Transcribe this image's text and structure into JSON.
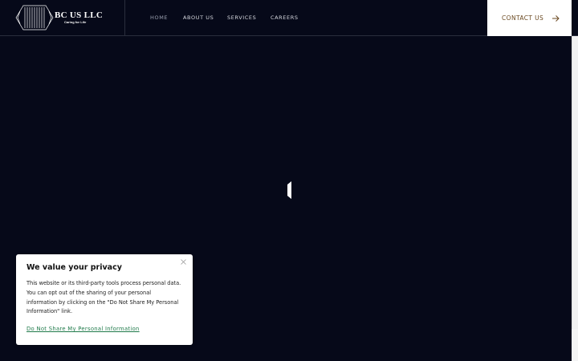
{
  "header": {
    "logo": {
      "name": "BC US  LLC",
      "tagline": "Caring for Life",
      "icon": "hexagon-lines-logo-icon"
    },
    "nav": [
      {
        "label": "HOME",
        "active": true
      },
      {
        "label": "ABOUT US",
        "active": false
      },
      {
        "label": "SERVICES",
        "active": false
      },
      {
        "label": "CAREERS",
        "active": false
      }
    ],
    "contact": {
      "label": "CONTACT US",
      "icon": "arrow-right-icon"
    }
  },
  "loader": {
    "icon": "loading-spinner-icon"
  },
  "privacy": {
    "title": "We value your privacy",
    "body": "This website or its third-party tools process personal data. You can opt out of the sharing of your personal information by clicking on the \"Do Not Share My Personal Information\" link.",
    "link": "Do Not Share My Personal Information",
    "close_icon": "close-icon"
  },
  "colors": {
    "background": "#060919",
    "contact_text": "#6b4a22",
    "privacy_link": "#1f7a4a",
    "divider": "#2a2e3d"
  }
}
